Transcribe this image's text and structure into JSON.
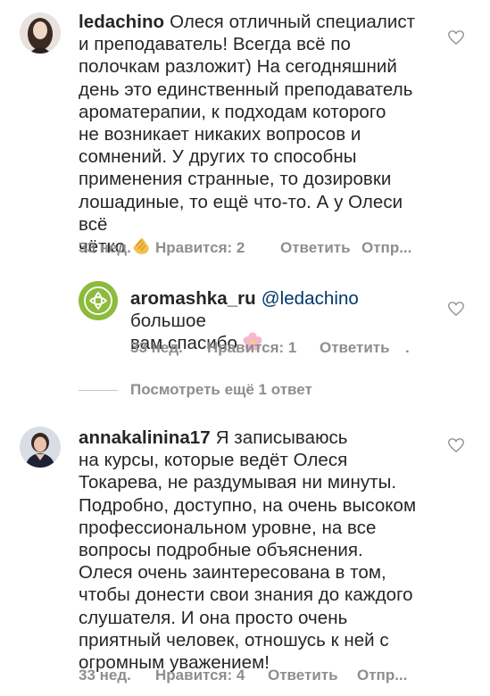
{
  "comments": [
    {
      "username": "ledachino",
      "text_lines": [
        "Олеся отличный специалист",
        "и преподаватель! Всегда всё по",
        "полочкам разложит) На сегодняшний",
        "день это единственный преподаватель",
        "ароматерапии, к подходам которого",
        "не возникает никаких вопросов и",
        "сомнений. У других то способны",
        "применения странные, то дозировки",
        "лошадиные, то ещё что-то. А у Олеси всё",
        "чётко"
      ],
      "end_emoji": "clapping-hands-icon",
      "time": "33 нед.",
      "likes": "Нравится: 2",
      "reply": "Ответить",
      "send": "Отпр..."
    },
    {
      "username": "aromashka_ru",
      "mention": "@ledachino",
      "text_first": "большое",
      "text_second": "вам спасибо",
      "end_emoji": "cherry-blossom-icon",
      "time": "33 нед.",
      "likes": "Нравится: 1",
      "reply": "Ответить",
      "send": "."
    },
    {
      "username": "annakalinina17",
      "text_lines": [
        "Я записываюсь",
        "на курсы, которые ведёт Олеся",
        "Токарева, не раздумывая ни минуты.",
        "Подробно, доступно, на очень высоком",
        "профессиональном уровне, на все",
        "вопросы подробные объяснения.",
        "Олеся очень заинтересована в том,",
        "чтобы донести свои знания до каждого",
        "слушателя. И она просто очень",
        "приятный человек, отношусь к ней с",
        "огромным уважением!"
      ],
      "time": "33 нед.",
      "likes": "Нравится: 4",
      "reply": "Ответить",
      "send": "Отпр..."
    }
  ],
  "view_more": "Посмотреть ещё 1 ответ",
  "colors": {
    "text": "#262626",
    "meta": "#8e8e8e",
    "mention": "#00376b",
    "brand_green": "#8dbb3c"
  }
}
